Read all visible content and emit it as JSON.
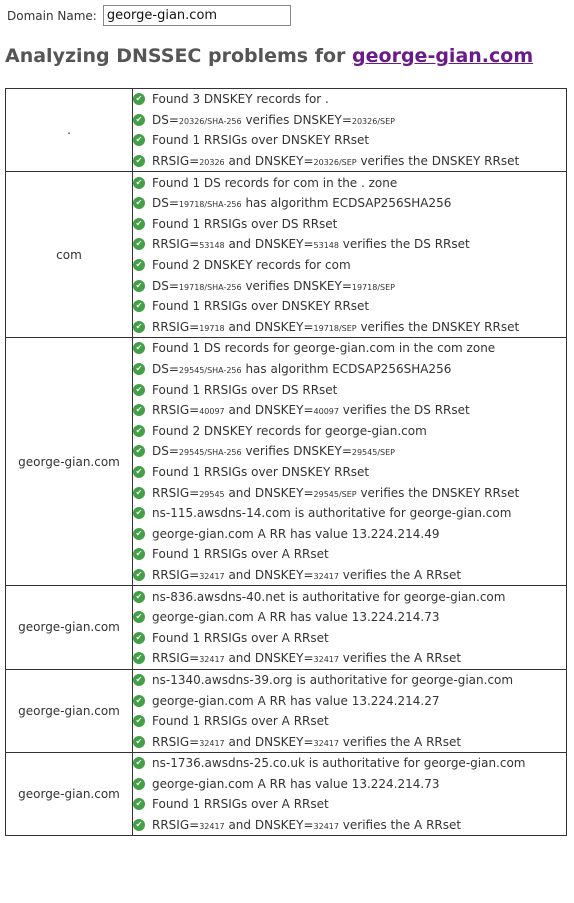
{
  "form": {
    "label": "Domain Name:",
    "value": "george-gian.com"
  },
  "heading": {
    "prefix": "Analyzing DNSSEC problems for ",
    "domain": "george-gian.com"
  },
  "check_icon": "check-circle-icon",
  "colors": {
    "ok": "#43a047",
    "link": "#6a1b8a"
  },
  "zones": [
    {
      "name": ".",
      "lines": [
        [
          "Found 3 DNSKEY records for ."
        ],
        [
          "DS=",
          {
            "s": "20326/SHA-256"
          },
          " verifies DNSKEY=",
          {
            "s": "20326/SEP"
          }
        ],
        [
          "Found 1 RRSIGs over DNSKEY RRset"
        ],
        [
          "RRSIG=",
          {
            "s": "20326"
          },
          " and DNSKEY=",
          {
            "s": "20326/SEP"
          },
          " verifies the DNSKEY RRset"
        ]
      ]
    },
    {
      "name": "com",
      "lines": [
        [
          "Found 1 DS records for com in the . zone"
        ],
        [
          "DS=",
          {
            "s": "19718/SHA-256"
          },
          " has algorithm ECDSAP256SHA256"
        ],
        [
          "Found 1 RRSIGs over DS RRset"
        ],
        [
          "RRSIG=",
          {
            "s": "53148"
          },
          " and DNSKEY=",
          {
            "s": "53148"
          },
          " verifies the DS RRset"
        ],
        [
          "Found 2 DNSKEY records for com"
        ],
        [
          "DS=",
          {
            "s": "19718/SHA-256"
          },
          " verifies DNSKEY=",
          {
            "s": "19718/SEP"
          }
        ],
        [
          "Found 1 RRSIGs over DNSKEY RRset"
        ],
        [
          "RRSIG=",
          {
            "s": "19718"
          },
          " and DNSKEY=",
          {
            "s": "19718/SEP"
          },
          " verifies the DNSKEY RRset"
        ]
      ]
    },
    {
      "name": "george-gian.com",
      "lines": [
        [
          "Found 1 DS records for george-gian.com in the com zone"
        ],
        [
          "DS=",
          {
            "s": "29545/SHA-256"
          },
          " has algorithm ECDSAP256SHA256"
        ],
        [
          "Found 1 RRSIGs over DS RRset"
        ],
        [
          "RRSIG=",
          {
            "s": "40097"
          },
          " and DNSKEY=",
          {
            "s": "40097"
          },
          " verifies the DS RRset"
        ],
        [
          "Found 2 DNSKEY records for george-gian.com"
        ],
        [
          "DS=",
          {
            "s": "29545/SHA-256"
          },
          " verifies DNSKEY=",
          {
            "s": "29545/SEP"
          }
        ],
        [
          "Found 1 RRSIGs over DNSKEY RRset"
        ],
        [
          "RRSIG=",
          {
            "s": "29545"
          },
          " and DNSKEY=",
          {
            "s": "29545/SEP"
          },
          " verifies the DNSKEY RRset"
        ],
        [
          "ns-115.awsdns-14.com is authoritative for george-gian.com"
        ],
        [
          "george-gian.com A RR has value 13.224.214.49"
        ],
        [
          "Found 1 RRSIGs over A RRset"
        ],
        [
          "RRSIG=",
          {
            "s": "32417"
          },
          " and DNSKEY=",
          {
            "s": "32417"
          },
          " verifies the A RRset"
        ]
      ]
    },
    {
      "name": "george-gian.com",
      "lines": [
        [
          "ns-836.awsdns-40.net is authoritative for george-gian.com"
        ],
        [
          "george-gian.com A RR has value 13.224.214.73"
        ],
        [
          "Found 1 RRSIGs over A RRset"
        ],
        [
          "RRSIG=",
          {
            "s": "32417"
          },
          " and DNSKEY=",
          {
            "s": "32417"
          },
          " verifies the A RRset"
        ]
      ]
    },
    {
      "name": "george-gian.com",
      "lines": [
        [
          "ns-1340.awsdns-39.org is authoritative for george-gian.com"
        ],
        [
          "george-gian.com A RR has value 13.224.214.27"
        ],
        [
          "Found 1 RRSIGs over A RRset"
        ],
        [
          "RRSIG=",
          {
            "s": "32417"
          },
          " and DNSKEY=",
          {
            "s": "32417"
          },
          " verifies the A RRset"
        ]
      ]
    },
    {
      "name": "george-gian.com",
      "lines": [
        [
          "ns-1736.awsdns-25.co.uk is authoritative for george-gian.com"
        ],
        [
          "george-gian.com A RR has value 13.224.214.73"
        ],
        [
          "Found 1 RRSIGs over A RRset"
        ],
        [
          "RRSIG=",
          {
            "s": "32417"
          },
          " and DNSKEY=",
          {
            "s": "32417"
          },
          " verifies the A RRset"
        ]
      ]
    }
  ]
}
